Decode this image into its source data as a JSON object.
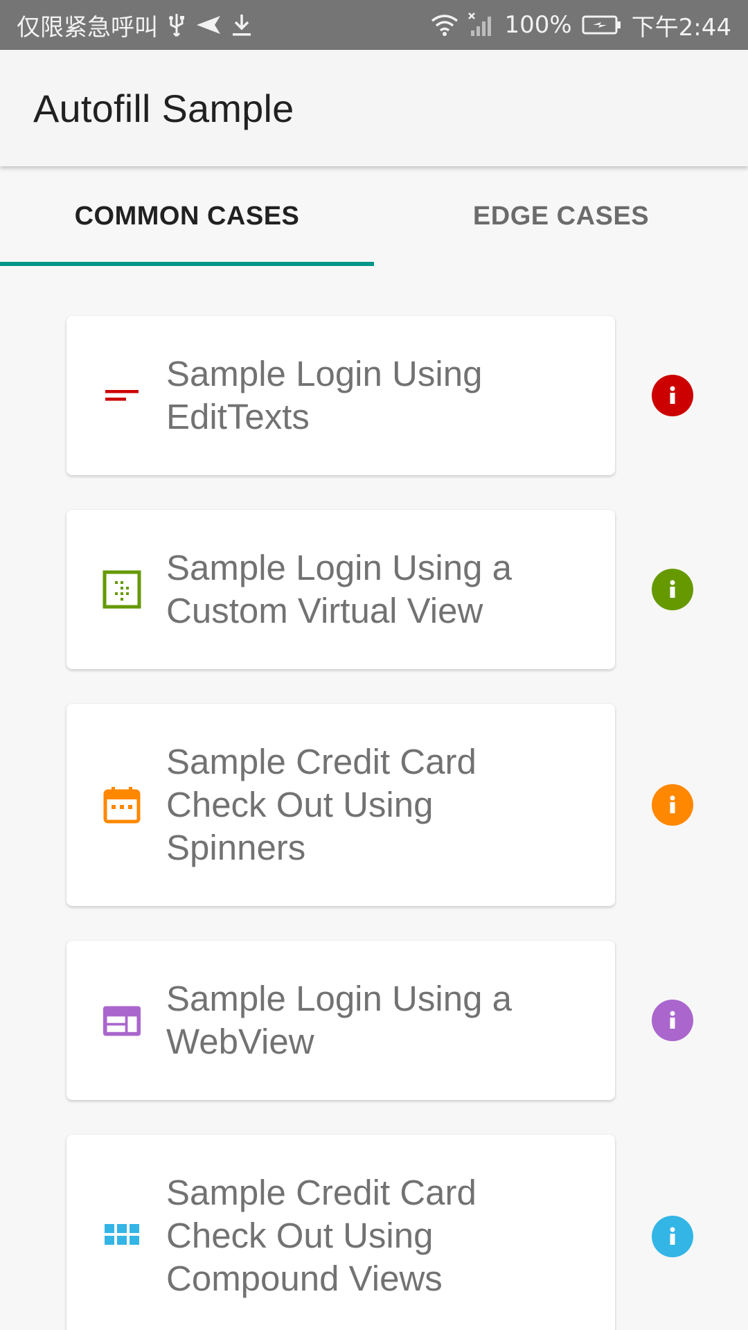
{
  "status_bar": {
    "carrier_text": "仅限紧急呼叫",
    "battery": "100%",
    "time": "下午2:44",
    "icons": [
      "usb-icon",
      "send-icon",
      "download-icon",
      "wifi-icon",
      "signal-icon",
      "battery-icon"
    ]
  },
  "app_bar": {
    "title": "Autofill Sample"
  },
  "tabs": [
    {
      "label": "COMMON CASES",
      "selected": true
    },
    {
      "label": "EDGE CASES",
      "selected": false
    }
  ],
  "colors": {
    "tab_indicator": "#009688",
    "red": "#cc0000",
    "green": "#669900",
    "orange": "#ff8800",
    "purple": "#aa66cc",
    "blue": "#33b5e5"
  },
  "cards": [
    {
      "label": "Sample Login Using EditTexts",
      "icon": "edit-text-icon",
      "info_icon": "info-icon"
    },
    {
      "label": "Sample Login Using a Custom Virtual View",
      "icon": "virtual-view-icon",
      "info_icon": "info-icon"
    },
    {
      "label": "Sample Credit Card Check Out Using Spinners",
      "icon": "calendar-icon",
      "info_icon": "info-icon"
    },
    {
      "label": "Sample Login Using a WebView",
      "icon": "webview-icon",
      "info_icon": "info-icon"
    },
    {
      "label": "Sample Credit Card Check Out Using Compound Views",
      "icon": "grid-icon",
      "info_icon": "info-icon"
    }
  ]
}
